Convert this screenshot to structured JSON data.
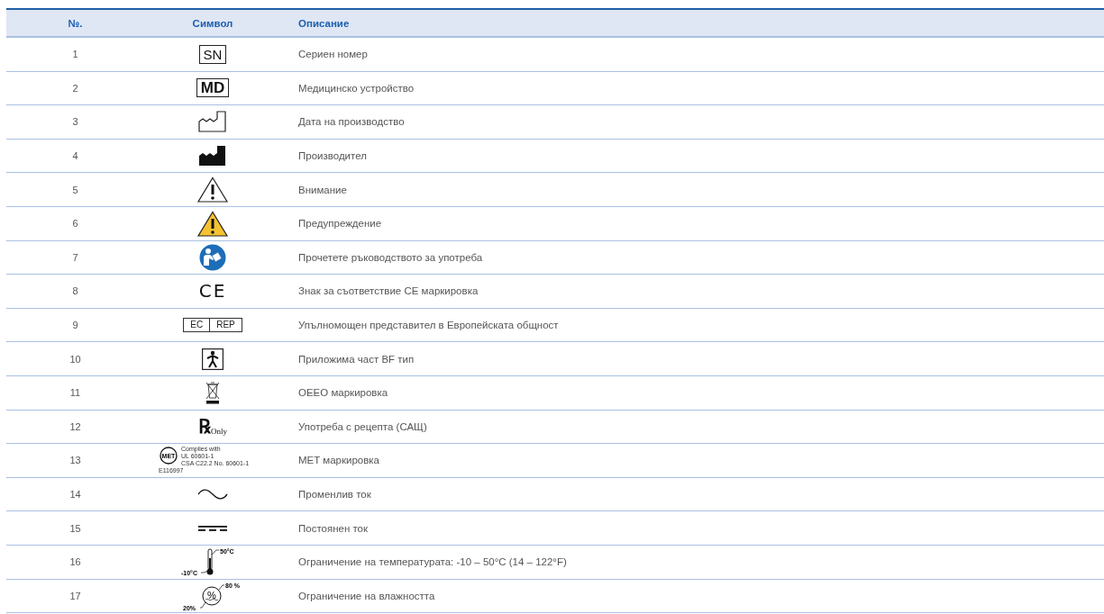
{
  "table": {
    "columns": [
      "№.",
      "Символ",
      "Описание"
    ],
    "rows": [
      {
        "number": "1",
        "symbol": {
          "kind": "boxed",
          "texts": [
            "SN"
          ]
        },
        "description": "Сериен номер"
      },
      {
        "number": "2",
        "symbol": {
          "kind": "boxed-bold",
          "texts": [
            "MD"
          ]
        },
        "description": "Медицинско устройство"
      },
      {
        "number": "3",
        "symbol": {
          "kind": "factory-outline"
        },
        "description": "Дата на производство"
      },
      {
        "number": "4",
        "symbol": {
          "kind": "factory"
        },
        "description": "Производител"
      },
      {
        "number": "5",
        "symbol": {
          "kind": "caution"
        },
        "description": "Внимание"
      },
      {
        "number": "6",
        "symbol": {
          "kind": "warning"
        },
        "description": "Предупреждение"
      },
      {
        "number": "7",
        "symbol": {
          "kind": "manual"
        },
        "description": "Прочетете ръководството за употреба"
      },
      {
        "number": "8",
        "symbol": {
          "kind": "ce",
          "texts": [
            "CE"
          ]
        },
        "description": "Знак за съответствие CE маркировка"
      },
      {
        "number": "9",
        "symbol": {
          "kind": "split-box",
          "texts": [
            "EC",
            "REP"
          ]
        },
        "description": "Упълномощен представител в Европейската общност"
      },
      {
        "number": "10",
        "symbol": {
          "kind": "bf"
        },
        "description": "Приложима част BF тип"
      },
      {
        "number": "11",
        "symbol": {
          "kind": "weee"
        },
        "description": "ОЕЕО маркировка"
      },
      {
        "number": "12",
        "symbol": {
          "kind": "rx",
          "texts": [
            "℞",
            "Only"
          ]
        },
        "description": "Употреба с рецепта (САЩ)"
      },
      {
        "number": "13",
        "symbol": {
          "kind": "met",
          "texts": [
            "MET",
            "Complies with",
            "UL 60601-1",
            "CSA C22.2 No. 60601-1",
            "E116997"
          ]
        },
        "description": "MET маркировка"
      },
      {
        "number": "14",
        "symbol": {
          "kind": "ac"
        },
        "description": "Променлив ток"
      },
      {
        "number": "15",
        "symbol": {
          "kind": "dc"
        },
        "description": "Постоянен ток"
      },
      {
        "number": "16",
        "symbol": {
          "kind": "temperature",
          "texts": [
            "50°C",
            "-10°C"
          ]
        },
        "description": "Ограничение на температурата: -10 – 50°C (14 – 122°F)"
      },
      {
        "number": "17",
        "symbol": {
          "kind": "humidity",
          "texts": [
            "%",
            "80 %",
            "20%"
          ]
        },
        "description": "Ограничение на влажността"
      }
    ]
  }
}
